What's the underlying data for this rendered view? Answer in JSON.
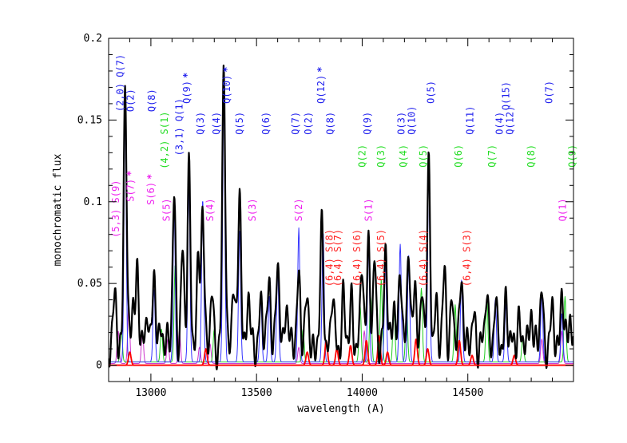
{
  "chart_data": {
    "type": "line",
    "xlabel": "wavelength (A)",
    "ylabel": "monochromatic flux",
    "xlim": [
      12800,
      15000
    ],
    "ylim": [
      -0.01,
      0.2
    ],
    "x_ticks": [
      13000,
      13500,
      14000,
      14500
    ],
    "x_tick_labels": [
      "13000",
      "13500",
      "14000",
      "14500"
    ],
    "y_ticks": [
      0,
      0.05,
      0.1,
      0.15,
      0.2
    ],
    "y_tick_labels": [
      "0",
      "0.05",
      "0.1",
      "0.15",
      "0.2"
    ],
    "colors": {
      "observed": "#000000",
      "model_blue": "#3333ff",
      "model_green": "#22cc22",
      "model_magenta": "#cc33cc",
      "model_red": "#ff0000",
      "label_blue": "#2222ee",
      "label_green": "#22dd22",
      "label_magenta": "#ee22ee",
      "label_red": "#ff2222"
    },
    "series": [
      {
        "key": "observed",
        "peaks": [
          [
            12830,
            0.03
          ],
          [
            12878,
            0.158
          ],
          [
            12915,
            0.03
          ],
          [
            12935,
            0.045
          ],
          [
            12985,
            0.025
          ],
          [
            13015,
            0.04
          ],
          [
            13050,
            0.015
          ],
          [
            13110,
            0.095
          ],
          [
            13150,
            0.055
          ],
          [
            13180,
            0.113
          ],
          [
            13225,
            0.048
          ],
          [
            13245,
            0.09
          ],
          [
            13290,
            0.03
          ],
          [
            13345,
            0.168
          ],
          [
            13390,
            0.04
          ],
          [
            13420,
            0.095
          ],
          [
            13460,
            0.03
          ],
          [
            13520,
            0.03
          ],
          [
            13560,
            0.045
          ],
          [
            13600,
            0.05
          ],
          [
            13640,
            0.03
          ],
          [
            13700,
            0.05
          ],
          [
            13740,
            0.03
          ],
          [
            13810,
            0.075
          ],
          [
            13860,
            0.03
          ],
          [
            13910,
            0.03
          ],
          [
            13950,
            0.03
          ],
          [
            14000,
            0.05
          ],
          [
            14030,
            0.068
          ],
          [
            14060,
            0.048
          ],
          [
            14110,
            0.06
          ],
          [
            14150,
            0.03
          ],
          [
            14180,
            0.045
          ],
          [
            14220,
            0.065
          ],
          [
            14250,
            0.035
          ],
          [
            14285,
            0.04
          ],
          [
            14315,
            0.105
          ],
          [
            14350,
            0.03
          ],
          [
            14390,
            0.045
          ],
          [
            14425,
            0.03
          ],
          [
            14470,
            0.048
          ],
          [
            14530,
            0.02
          ],
          [
            14590,
            0.035
          ],
          [
            14630,
            0.025
          ],
          [
            14680,
            0.03
          ],
          [
            14740,
            0.02
          ],
          [
            14800,
            0.025
          ],
          [
            14850,
            0.035
          ],
          [
            14900,
            0.02
          ],
          [
            14945,
            0.035
          ],
          [
            14985,
            0.02
          ]
        ],
        "width": 7,
        "baseline": 0.012
      },
      {
        "key": "model_blue",
        "peaks": [
          [
            12878,
            0.16
          ],
          [
            13015,
            0.045
          ],
          [
            13110,
            0.095
          ],
          [
            13180,
            0.11
          ],
          [
            13245,
            0.1
          ],
          [
            13345,
            0.17
          ],
          [
            13420,
            0.08
          ],
          [
            13520,
            0.04
          ],
          [
            13560,
            0.04
          ],
          [
            13600,
            0.055
          ],
          [
            13700,
            0.082
          ],
          [
            13815,
            0.08
          ],
          [
            14030,
            0.07
          ],
          [
            14110,
            0.06
          ],
          [
            14180,
            0.072
          ],
          [
            14220,
            0.065
          ],
          [
            14315,
            0.118
          ],
          [
            14470,
            0.05
          ],
          [
            14630,
            0.038
          ],
          [
            14680,
            0.035
          ],
          [
            14850,
            0.042
          ],
          [
            14945,
            0.03
          ]
        ],
        "width": 5,
        "baseline": 0.002
      },
      {
        "key": "model_green",
        "peaks": [
          [
            12860,
            0.02
          ],
          [
            13050,
            0.02
          ],
          [
            13115,
            0.06
          ],
          [
            13300,
            0.02
          ],
          [
            13720,
            0.02
          ],
          [
            13990,
            0.035
          ],
          [
            14040,
            0.04
          ],
          [
            14090,
            0.05
          ],
          [
            14150,
            0.035
          ],
          [
            14210,
            0.035
          ],
          [
            14280,
            0.045
          ],
          [
            14440,
            0.035
          ],
          [
            14590,
            0.038
          ],
          [
            14760,
            0.015
          ],
          [
            14960,
            0.04
          ]
        ],
        "width": 5,
        "baseline": 0.002
      },
      {
        "key": "model_magenta",
        "peaks": [
          [
            12845,
            0.02
          ],
          [
            12895,
            0.035
          ],
          [
            12960,
            0.02
          ],
          [
            13080,
            0.015
          ],
          [
            13135,
            0.02
          ],
          [
            13230,
            0.01
          ],
          [
            13280,
            0.012
          ],
          [
            13700,
            0.01
          ],
          [
            14010,
            0.02
          ],
          [
            14850,
            0.015
          ],
          [
            14945,
            0.02
          ]
        ],
        "width": 5,
        "baseline": 0.001
      },
      {
        "key": "model_red",
        "peaks": [
          [
            12900,
            0.008
          ],
          [
            13260,
            0.01
          ],
          [
            13740,
            0.008
          ],
          [
            13830,
            0.015
          ],
          [
            13880,
            0.01
          ],
          [
            13945,
            0.012
          ],
          [
            14020,
            0.015
          ],
          [
            14080,
            0.018
          ],
          [
            14120,
            0.008
          ],
          [
            14255,
            0.016
          ],
          [
            14310,
            0.01
          ],
          [
            14460,
            0.015
          ],
          [
            14520,
            0.006
          ],
          [
            14720,
            0.006
          ]
        ],
        "width": 6,
        "baseline": 0.0
      }
    ],
    "line_labels": [
      {
        "text": "(2,0) Q(7)",
        "x": 12870,
        "y": 0.155,
        "color": "label_blue",
        "mark": false
      },
      {
        "text": "O(2)",
        "x": 12920,
        "y": 0.155,
        "color": "label_blue",
        "mark": false
      },
      {
        "text": "Q(8)",
        "x": 13020,
        "y": 0.155,
        "color": "label_blue",
        "mark": false
      },
      {
        "text": "Q(9)",
        "x": 13185,
        "y": 0.16,
        "color": "label_blue",
        "mark": true
      },
      {
        "text": "(3,1) Q(1)",
        "x": 13150,
        "y": 0.128,
        "color": "label_blue",
        "mark": false
      },
      {
        "text": "Q(3)",
        "x": 13250,
        "y": 0.141,
        "color": "label_blue",
        "mark": false
      },
      {
        "text": "Q(4)",
        "x": 13325,
        "y": 0.141,
        "color": "label_blue",
        "mark": false
      },
      {
        "text": "Q(10)",
        "x": 13375,
        "y": 0.16,
        "color": "label_blue",
        "mark": true
      },
      {
        "text": "Q(5)",
        "x": 13435,
        "y": 0.141,
        "color": "label_blue",
        "mark": false
      },
      {
        "text": "Q(6)",
        "x": 13560,
        "y": 0.141,
        "color": "label_blue",
        "mark": false
      },
      {
        "text": "Q(7)",
        "x": 13700,
        "y": 0.141,
        "color": "label_blue",
        "mark": false
      },
      {
        "text": "O(2)",
        "x": 13760,
        "y": 0.141,
        "color": "label_blue",
        "mark": false
      },
      {
        "text": "Q(12)",
        "x": 13820,
        "y": 0.16,
        "color": "label_blue",
        "mark": true
      },
      {
        "text": "Q(8)",
        "x": 13865,
        "y": 0.141,
        "color": "label_blue",
        "mark": false
      },
      {
        "text": "Q(9)",
        "x": 14040,
        "y": 0.141,
        "color": "label_blue",
        "mark": false
      },
      {
        "text": "O(3)",
        "x": 14200,
        "y": 0.141,
        "color": "label_blue",
        "mark": false
      },
      {
        "text": "Q(10)",
        "x": 14250,
        "y": 0.141,
        "color": "label_blue",
        "mark": false
      },
      {
        "text": "O(5)",
        "x": 14340,
        "y": 0.16,
        "color": "label_blue",
        "mark": false
      },
      {
        "text": "Q(11)",
        "x": 14525,
        "y": 0.141,
        "color": "label_blue",
        "mark": false
      },
      {
        "text": "Q(15)",
        "x": 14695,
        "y": 0.156,
        "color": "label_blue",
        "mark": false
      },
      {
        "text": "O(4)",
        "x": 14665,
        "y": 0.141,
        "color": "label_blue",
        "mark": false
      },
      {
        "text": "Q(12)",
        "x": 14715,
        "y": 0.141,
        "color": "label_blue",
        "mark": false
      },
      {
        "text": "O(7)",
        "x": 14900,
        "y": 0.16,
        "color": "label_blue",
        "mark": false
      },
      {
        "text": "(4,2) S(1)",
        "x": 13080,
        "y": 0.12,
        "color": "label_green",
        "mark": false
      },
      {
        "text": "Q(2)",
        "x": 14015,
        "y": 0.121,
        "color": "label_green",
        "mark": false
      },
      {
        "text": "Q(3)",
        "x": 14105,
        "y": 0.121,
        "color": "label_green",
        "mark": false
      },
      {
        "text": "Q(4)",
        "x": 14210,
        "y": 0.121,
        "color": "label_green",
        "mark": false
      },
      {
        "text": "Q(5)",
        "x": 14305,
        "y": 0.121,
        "color": "label_green",
        "mark": false
      },
      {
        "text": "Q(6)",
        "x": 14470,
        "y": 0.121,
        "color": "label_green",
        "mark": false
      },
      {
        "text": "Q(7)",
        "x": 14630,
        "y": 0.121,
        "color": "label_green",
        "mark": false
      },
      {
        "text": "Q(8)",
        "x": 14815,
        "y": 0.121,
        "color": "label_green",
        "mark": false
      },
      {
        "text": "Q(9)",
        "x": 15010,
        "y": 0.121,
        "color": "label_green",
        "mark": false
      },
      {
        "text": "(5,3) S(9)",
        "x": 12850,
        "y": 0.078,
        "color": "label_magenta",
        "mark": false
      },
      {
        "text": "S(7)",
        "x": 12920,
        "y": 0.1,
        "color": "label_magenta",
        "mark": true
      },
      {
        "text": "S(6)",
        "x": 13015,
        "y": 0.098,
        "color": "label_magenta",
        "mark": true
      },
      {
        "text": "S(5)",
        "x": 13090,
        "y": 0.088,
        "color": "label_magenta",
        "mark": false
      },
      {
        "text": "S(4)",
        "x": 13295,
        "y": 0.088,
        "color": "label_magenta",
        "mark": false
      },
      {
        "text": "S(3)",
        "x": 13495,
        "y": 0.088,
        "color": "label_magenta",
        "mark": false
      },
      {
        "text": "S(2)",
        "x": 13715,
        "y": 0.088,
        "color": "label_magenta",
        "mark": false
      },
      {
        "text": "S(1)",
        "x": 14045,
        "y": 0.088,
        "color": "label_magenta",
        "mark": false
      },
      {
        "text": "Q(1)",
        "x": 14965,
        "y": 0.088,
        "color": "label_magenta",
        "mark": false
      },
      {
        "text": "(6,4) S(8)",
        "x": 13860,
        "y": 0.048,
        "color": "label_red",
        "mark": false
      },
      {
        "text": "(6,4) S(7)",
        "x": 13900,
        "y": 0.048,
        "color": "label_red",
        "mark": false
      },
      {
        "text": "(6,4) S(6)",
        "x": 13990,
        "y": 0.048,
        "color": "label_red",
        "mark": false
      },
      {
        "text": "(6,4) S(5)",
        "x": 14105,
        "y": 0.048,
        "color": "label_red",
        "mark": false
      },
      {
        "text": "(6,4) S(4)",
        "x": 14305,
        "y": 0.048,
        "color": "label_red",
        "mark": false
      },
      {
        "text": "(6,4) S(3)",
        "x": 14510,
        "y": 0.048,
        "color": "label_red",
        "mark": false
      }
    ]
  }
}
